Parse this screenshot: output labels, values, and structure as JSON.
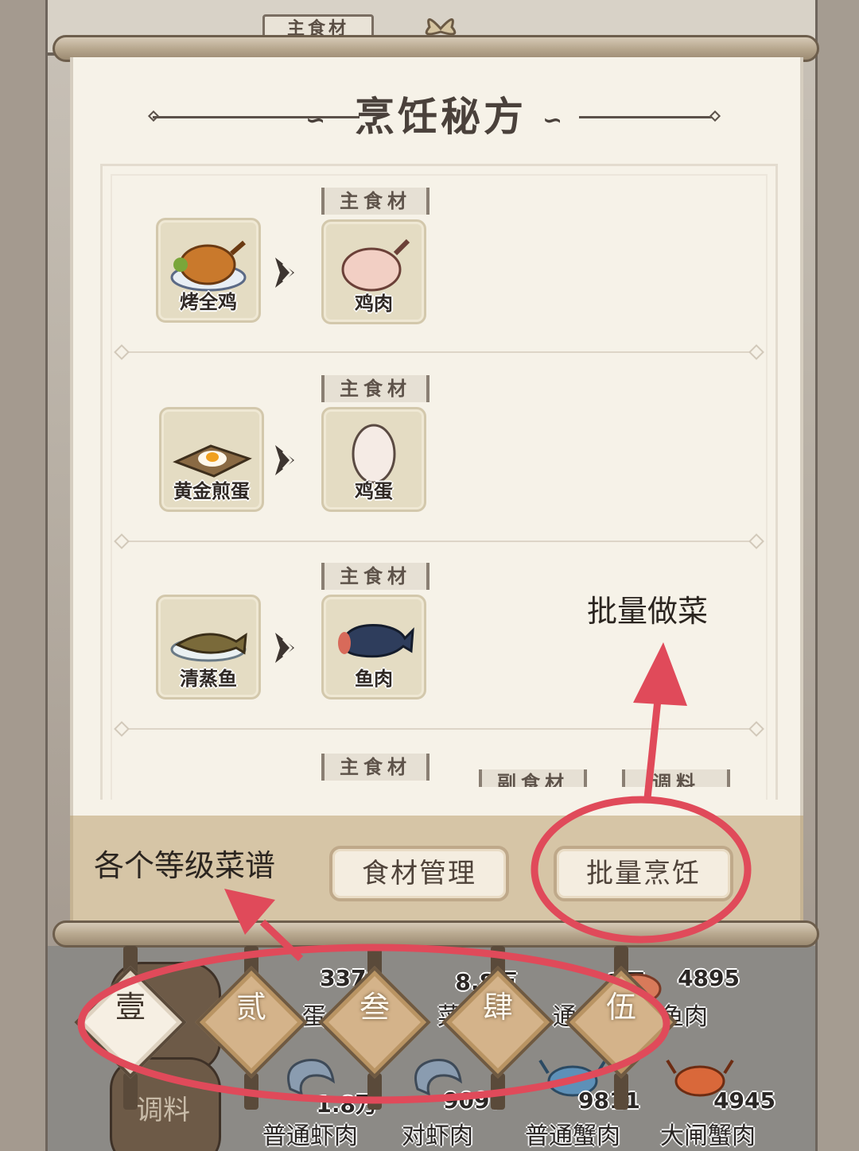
{
  "window": {
    "background_tag": "主食材"
  },
  "panel": {
    "title": "烹饪秘方",
    "recipes": [
      {
        "dish": "烤全鸡",
        "dish_icon": "roast-chicken-icon",
        "ingredient_tag": "主食材",
        "ingredient": "鸡肉",
        "ingredient_icon": "raw-chicken-icon"
      },
      {
        "dish": "黄金煎蛋",
        "dish_icon": "fried-egg-icon",
        "ingredient_tag": "主食材",
        "ingredient": "鸡蛋",
        "ingredient_icon": "egg-icon"
      },
      {
        "dish": "清蒸鱼",
        "dish_icon": "steamed-fish-icon",
        "ingredient_tag": "主食材",
        "ingredient": "鱼肉",
        "ingredient_icon": "fish-icon"
      }
    ],
    "partial_row_tags": [
      "主食材",
      "副食材",
      "调料"
    ]
  },
  "actions": {
    "ingredient_management": "食材管理",
    "batch_cooking": "批量烹饪"
  },
  "levels": {
    "items": [
      "壹",
      "贰",
      "叁",
      "肆",
      "伍"
    ],
    "active": "壹"
  },
  "side_tabs": {
    "side_ingredient": "副",
    "seasoning": "调料"
  },
  "inventory": {
    "row1": [
      {
        "count": "3378",
        "name": "蛋"
      },
      {
        "count": "8.8万",
        "name": "菜"
      },
      {
        "count": "2万",
        "name": "通鱼"
      },
      {
        "count": "4895",
        "name": "鲤鱼肉"
      }
    ],
    "row2": [
      {
        "count": "1.8万",
        "name": "普通虾肉"
      },
      {
        "count": "9097",
        "name": "对虾肉"
      },
      {
        "count": "9811",
        "name": "普通蟹肉"
      },
      {
        "count": "4945",
        "name": "大闸蟹肉"
      }
    ]
  },
  "annotations": {
    "batch_label": "批量做菜",
    "levels_label": "各个等级菜谱"
  },
  "colors": {
    "annotation_red": "#e04a5a",
    "panel_bg": "#f6f2e8",
    "action_bar": "#d6c5a6"
  }
}
